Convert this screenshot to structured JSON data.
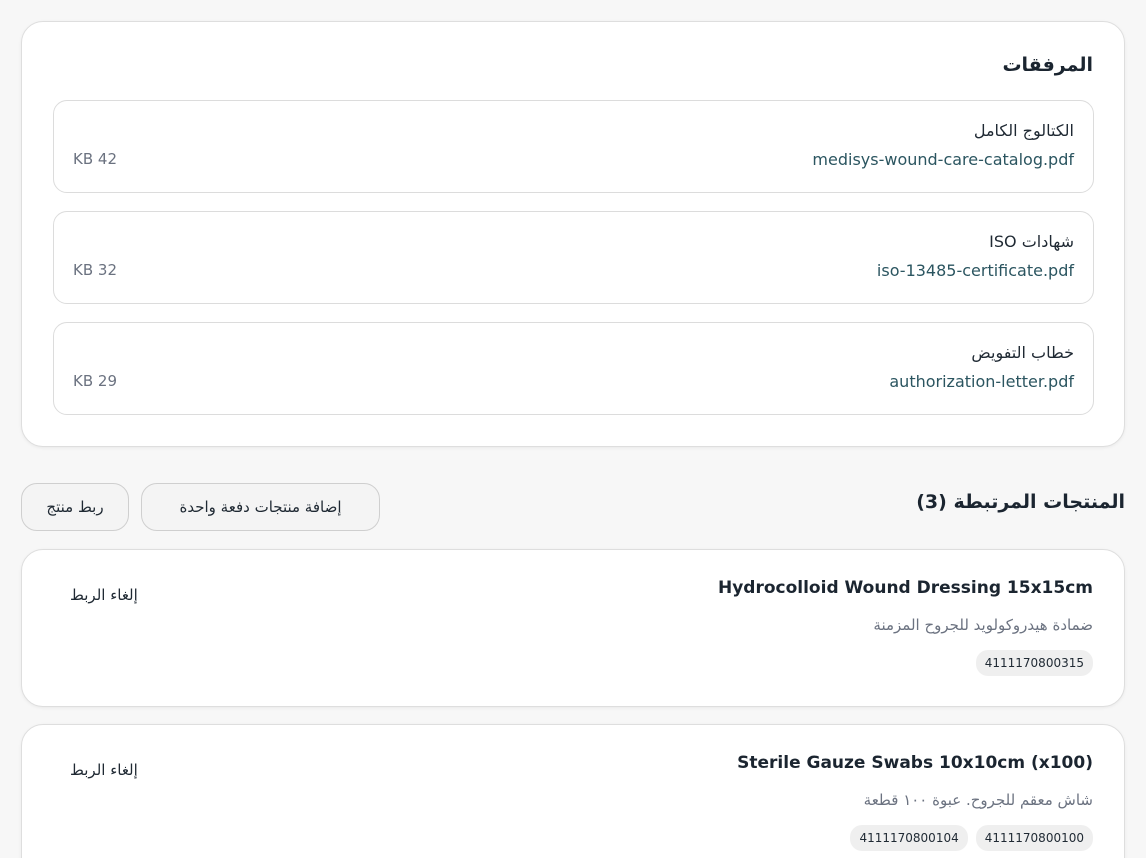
{
  "attachments": {
    "title": "المرفقات",
    "items": [
      {
        "label": "الكتالوج الكامل",
        "filename": "medisys-wound-care-catalog.pdf",
        "size": "KB 42"
      },
      {
        "label": "شهادات ISO",
        "filename": "iso-13485-certificate.pdf",
        "size": "KB 32"
      },
      {
        "label": "خطاب التفويض",
        "filename": "authorization-letter.pdf",
        "size": "KB 29"
      }
    ]
  },
  "linked_products": {
    "title": "المنتجات المرتبطة (3)",
    "link_button": "ربط منتج",
    "bulk_button": "إضافة منتجات دفعة واحدة",
    "unlink_label": "إلغاء الربط",
    "items": [
      {
        "name": "Hydrocolloid Wound Dressing 15x15cm",
        "description": "ضمادة هيدروكولويد للجروح المزمنة",
        "codes": [
          "4111170800315"
        ]
      },
      {
        "name": "Sterile Gauze Swabs 10x10cm (x100)",
        "description": "شاش معقم للجروح. عبوة ١٠٠ قطعة",
        "codes": [
          "4111170800100",
          "4111170800104"
        ]
      }
    ]
  }
}
